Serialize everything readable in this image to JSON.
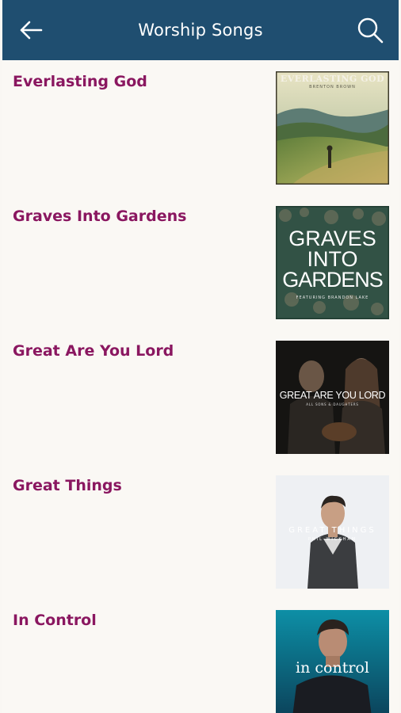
{
  "header": {
    "title": "Worship Songs",
    "back_icon": "arrow-left-icon",
    "search_icon": "search-icon",
    "background": "#1f4e70"
  },
  "songs": [
    {
      "title": "Everlasting God",
      "cover_text": [
        "EVERLASTING GOD",
        "BRENTON BROWN"
      ]
    },
    {
      "title": "Graves Into Gardens",
      "cover_text": [
        "GRAVES",
        "INTO",
        "GARDENS",
        "FEATURING BRANDON LAKE"
      ]
    },
    {
      "title": "Great Are You Lord",
      "cover_text": [
        "GREAT ARE YOU LORD",
        "ALL SONS & DAUGHTERS"
      ]
    },
    {
      "title": "Great Things",
      "cover_text": [
        "GREAT THINGS",
        "PHIL WICKHAM"
      ]
    },
    {
      "title": "In Control",
      "cover_text": [
        "in control"
      ]
    }
  ],
  "colors": {
    "title_text": "#8a1760",
    "background": "#faf8f4"
  }
}
